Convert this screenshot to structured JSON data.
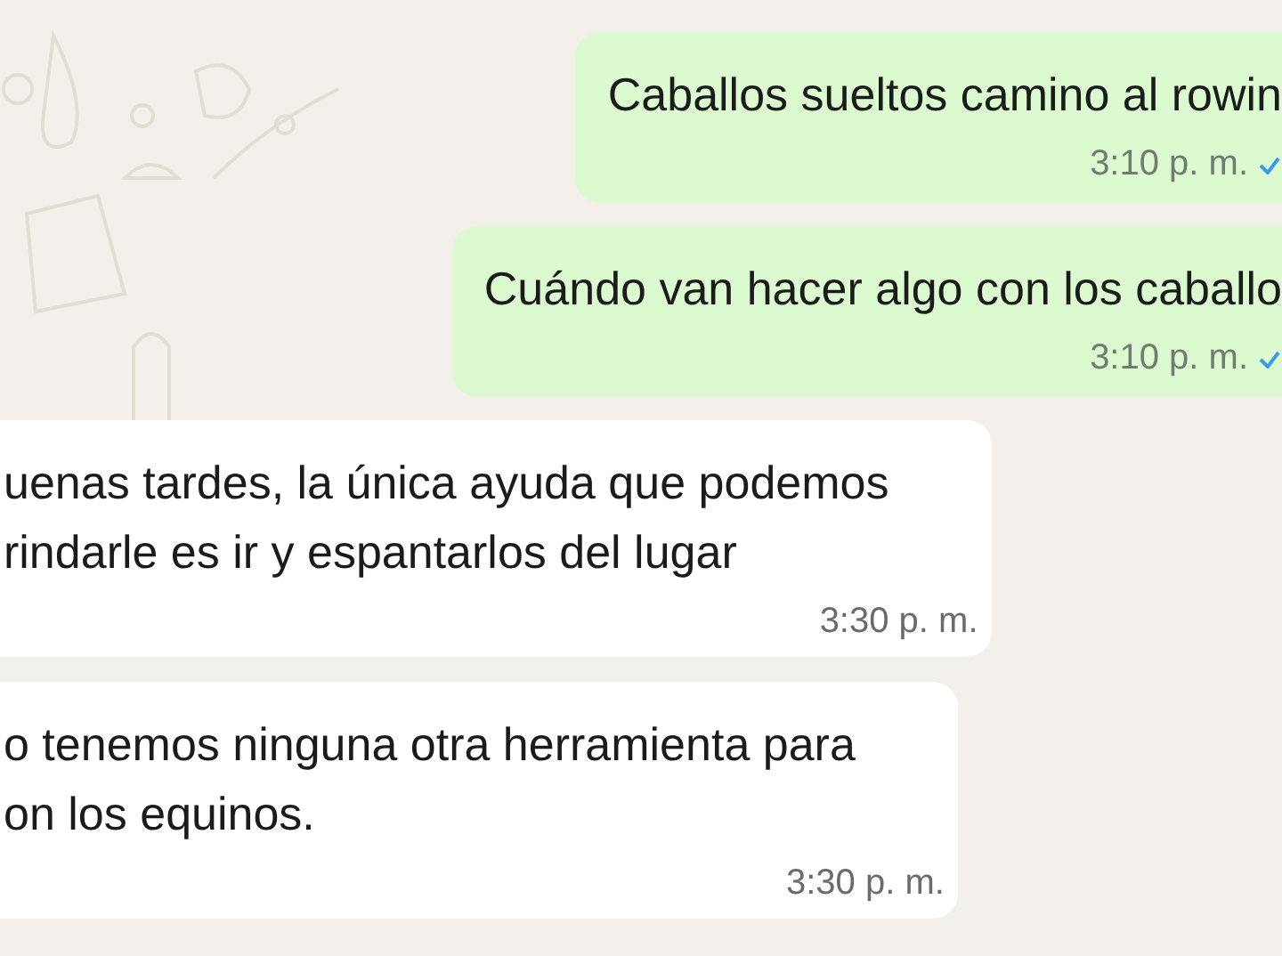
{
  "messages": [
    {
      "kind": "outgoing",
      "lines": [
        "Caballos sueltos camino al rowin"
      ],
      "time": "3:10 p. m.",
      "tick": true
    },
    {
      "kind": "outgoing",
      "lines": [
        "Cuándo van hacer algo con los caballo"
      ],
      "time": "3:10 p. m.",
      "tick": true
    },
    {
      "kind": "incoming",
      "lines": [
        "uenas tardes, la única ayuda que podemos",
        "rindarle es ir y espantarlos del lugar"
      ],
      "time": "3:30 p. m."
    },
    {
      "kind": "incoming",
      "lines": [
        "o tenemos ninguna otra herramienta para",
        "on los equinos."
      ],
      "time": "3:30 p. m."
    }
  ]
}
